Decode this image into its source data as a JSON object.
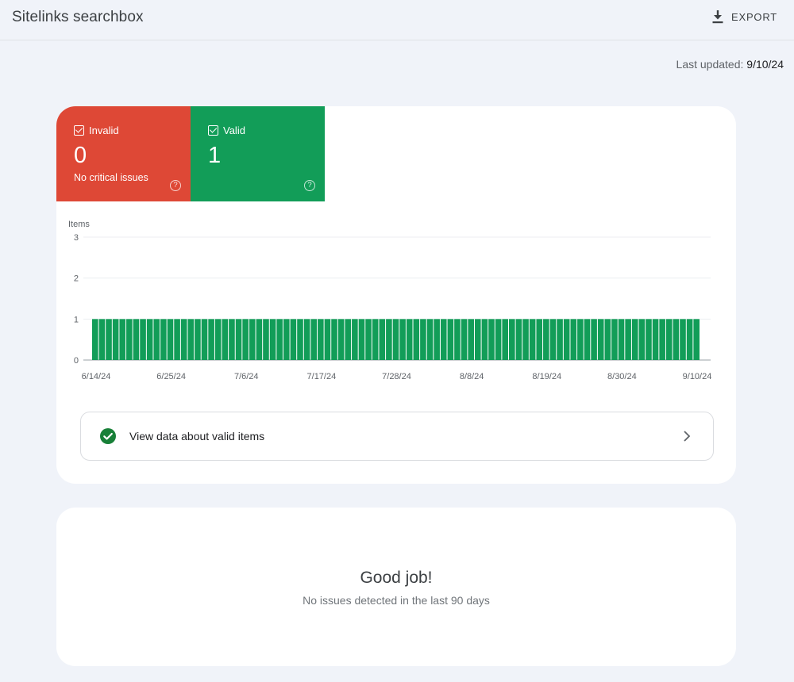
{
  "header": {
    "title": "Sitelinks searchbox",
    "export_label": "EXPORT",
    "export_icon": "download-icon"
  },
  "last_updated": {
    "label": "Last updated:",
    "date": "9/10/24"
  },
  "tiles": [
    {
      "label": "Invalid",
      "value": "0",
      "subtext": "No critical issues",
      "color": "#de4836",
      "checked": true
    },
    {
      "label": "Valid",
      "value": "1",
      "subtext": "",
      "color": "#129d58",
      "checked": true
    }
  ],
  "chart_data": {
    "type": "bar",
    "ylabel": "Items",
    "ylim": [
      0,
      3
    ],
    "yticks": [
      "0",
      "1",
      "2",
      "3"
    ],
    "xticks": [
      "6/14/24",
      "6/25/24",
      "7/6/24",
      "7/17/24",
      "7/28/24",
      "8/8/24",
      "8/19/24",
      "8/30/24",
      "9/10/24"
    ],
    "x_start": "6/14/24",
    "x_end": "9/10/24",
    "bar_color": "#129d58",
    "series": [
      {
        "values": [
          1,
          1,
          1,
          1,
          1,
          1,
          1,
          1,
          1,
          1,
          1,
          1,
          1,
          1,
          1,
          1,
          1,
          1,
          1,
          1,
          1,
          1,
          1,
          1,
          1,
          1,
          1,
          1,
          1,
          1,
          1,
          1,
          1,
          1,
          1,
          1,
          1,
          1,
          1,
          1,
          1,
          1,
          1,
          1,
          1,
          1,
          1,
          1,
          1,
          1,
          1,
          1,
          1,
          1,
          1,
          1,
          1,
          1,
          1,
          1,
          1,
          1,
          1,
          1,
          1,
          1,
          1,
          1,
          1,
          1,
          1,
          1,
          1,
          1,
          1,
          1,
          1,
          1,
          1,
          1,
          1,
          1,
          1,
          1,
          1,
          1,
          1,
          1,
          1
        ]
      }
    ]
  },
  "view_link": {
    "label": "View data about valid items",
    "icon": "check-circle-icon"
  },
  "good_job": {
    "title": "Good job!",
    "subtitle": "No issues detected in the last 90 days"
  }
}
